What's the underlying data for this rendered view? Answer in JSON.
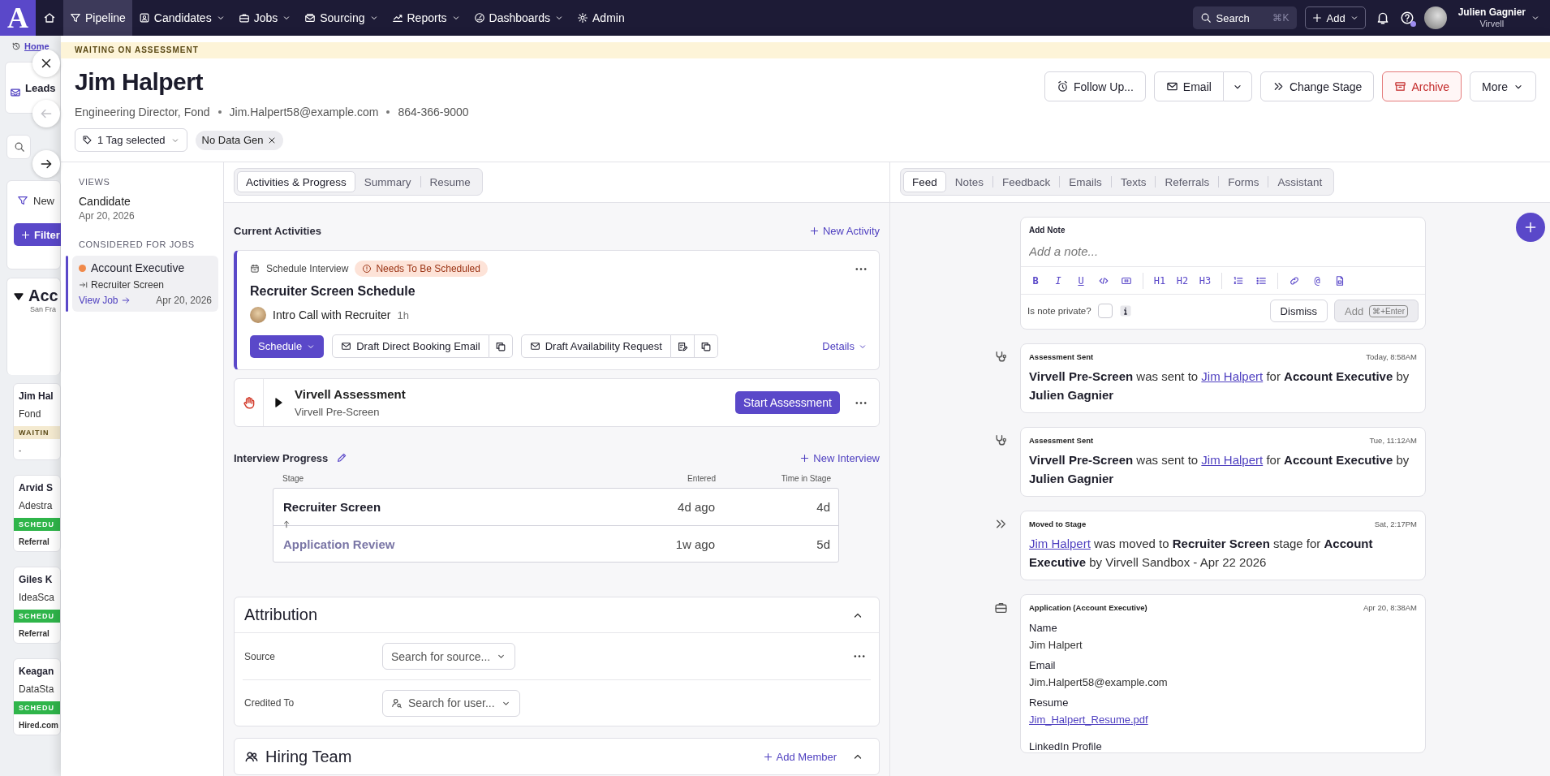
{
  "nav": {
    "logo": "A",
    "items": [
      {
        "label": "Pipeline",
        "selected": true,
        "has_menu": false
      },
      {
        "label": "Candidates",
        "selected": false,
        "has_menu": true
      },
      {
        "label": "Jobs",
        "selected": false,
        "has_menu": true
      },
      {
        "label": "Sourcing",
        "selected": false,
        "has_menu": true
      },
      {
        "label": "Reports",
        "selected": false,
        "has_menu": true
      },
      {
        "label": "Dashboards",
        "selected": false,
        "has_menu": true
      },
      {
        "label": "Admin",
        "selected": false,
        "has_menu": false
      }
    ],
    "search": {
      "label": "Search",
      "shortcut": "⌘K"
    },
    "add_button": "Add",
    "user": {
      "name": "Julien Gagnier",
      "org": "Virvell"
    }
  },
  "background": {
    "breadcrumb": "Home",
    "list_title": "Leads",
    "new_tab": "New",
    "filter_button": "Filter",
    "group": {
      "title": "Acc",
      "subtitle": "San Fra"
    },
    "cards": [
      {
        "name": "Jim Hal",
        "company": "Fond",
        "status": "WAITIN",
        "kind": "waiting",
        "footer": "-"
      },
      {
        "name": "Arvid S",
        "company": "Adestra",
        "status": "SCHEDU",
        "kind": "scheduled",
        "footer": "Referral"
      },
      {
        "name": "Giles K",
        "company": "IdeaSca",
        "status": "SCHEDU",
        "kind": "scheduled",
        "footer": "Referral"
      },
      {
        "name": "Keagan",
        "company": "DataSta",
        "status": "SCHEDU",
        "kind": "scheduled",
        "footer": "Hired.com"
      }
    ]
  },
  "drawer_nav": [
    {
      "kind": "close",
      "disabled": false
    },
    {
      "kind": "previous",
      "disabled": true
    },
    {
      "kind": "next",
      "disabled": false
    }
  ],
  "candidate": {
    "status_banner": "WAITING ON ASSESSMENT",
    "name": "Jim Halpert",
    "details": [
      "Engineering Director, Fond",
      "Jim.Halpert58@example.com",
      "864-366-9000"
    ],
    "tag_select": "1 Tag selected",
    "tags": [
      "No Data Gen"
    ],
    "actions": [
      {
        "label": "Follow Up...",
        "kind": "follow-up"
      },
      {
        "label": "Email",
        "kind": "split"
      },
      {
        "label": "Change Stage",
        "kind": "stage"
      },
      {
        "label": "Archive",
        "kind": "danger"
      },
      {
        "label": "More",
        "kind": "menu"
      }
    ]
  },
  "sidebar": {
    "views_heading": "VIEWS",
    "views": [
      {
        "title": "Candidate",
        "date": "Apr 20, 2026"
      }
    ],
    "jobs_heading": "CONSIDERED FOR JOBS",
    "jobs": [
      {
        "title": "Account Executive",
        "color": "#f0894a",
        "stage": "Recruiter Screen",
        "link": "View Job",
        "date": "Apr 20, 2026",
        "selected": true
      }
    ]
  },
  "activities": {
    "tabs": [
      {
        "label": "Activities & Progress",
        "selected": true
      },
      {
        "label": "Summary",
        "selected": false
      },
      {
        "label": "Resume",
        "selected": false
      }
    ],
    "heading": "Current Activities",
    "new_activity": "New Activity",
    "schedule_card": {
      "type_label": "Schedule Interview",
      "status": "Needs To Be Scheduled",
      "title": "Recruiter Screen Schedule",
      "meeting": "Intro Call with Recruiter",
      "duration": "1h",
      "schedule_button": "Schedule",
      "drafts": [
        "Draft Direct Booking Email",
        "Draft Availability Request"
      ],
      "details": "Details"
    },
    "assessment": {
      "title": "Virvell Assessment",
      "subtitle": "Virvell Pre-Screen",
      "button": "Start Assessment",
      "expanded": false
    },
    "progress": {
      "heading": "Interview Progress",
      "new_interview": "New Interview",
      "columns": [
        "Stage",
        "Entered",
        "Time in Stage"
      ],
      "rows": [
        {
          "stage": "Recruiter Screen",
          "entered": "4d ago",
          "time": "4d",
          "current": true
        },
        {
          "stage": "Application Review",
          "entered": "1w ago",
          "time": "5d",
          "current": false
        }
      ]
    },
    "attribution": {
      "title": "Attribution",
      "expanded": true,
      "fields": [
        {
          "label": "Source",
          "placeholder": "Search for source...",
          "kind": "source"
        },
        {
          "label": "Credited To",
          "placeholder": "Search for user...",
          "kind": "user"
        }
      ]
    },
    "hiring_team": {
      "title": "Hiring Team",
      "add": "Add Member",
      "expanded": true
    }
  },
  "feed": {
    "tabs": [
      {
        "label": "Feed",
        "selected": true
      },
      {
        "label": "Notes",
        "selected": false
      },
      {
        "label": "Feedback",
        "selected": false
      },
      {
        "label": "Emails",
        "selected": false
      },
      {
        "label": "Texts",
        "selected": false
      },
      {
        "label": "Referrals",
        "selected": false
      },
      {
        "label": "Forms",
        "selected": false
      },
      {
        "label": "Assistant",
        "selected": false
      }
    ],
    "note": {
      "title": "Add Note",
      "placeholder": "Add a note...",
      "toolbar": [
        {
          "kind": "bold",
          "label": "B"
        },
        {
          "kind": "italic",
          "label": "I"
        },
        {
          "kind": "underline",
          "label": "U"
        },
        {
          "kind": "code"
        },
        {
          "kind": "embed"
        },
        {
          "kind": "divider"
        },
        {
          "kind": "heading",
          "label": "H1"
        },
        {
          "kind": "heading",
          "label": "H2"
        },
        {
          "kind": "heading",
          "label": "H3"
        },
        {
          "kind": "divider"
        },
        {
          "kind": "ordered-list"
        },
        {
          "kind": "bullet-list"
        },
        {
          "kind": "divider"
        },
        {
          "kind": "link"
        },
        {
          "kind": "mention",
          "label": "@"
        },
        {
          "kind": "file"
        }
      ],
      "private_label": "Is note private?",
      "private": false,
      "dismiss": "Dismiss",
      "add": "Add",
      "add_shortcut": "⌘+Enter"
    },
    "events": [
      {
        "kind": "assessment",
        "title": "Assessment Sent",
        "time": "Today, 8:58AM",
        "parts": [
          {
            "text": "Virvell Pre-Screen",
            "kind": "bold"
          },
          {
            "text": " was sent to ",
            "kind": "plain"
          },
          {
            "text": "Jim Halpert",
            "kind": "link"
          },
          {
            "text": " for ",
            "kind": "plain"
          },
          {
            "text": "Account Executive",
            "kind": "bold"
          },
          {
            "text": " by ",
            "kind": "plain"
          },
          {
            "text": "Julien Gagnier",
            "kind": "bold"
          }
        ]
      },
      {
        "kind": "assessment",
        "title": "Assessment Sent",
        "time": "Tue, 11:12AM",
        "parts": [
          {
            "text": "Virvell Pre-Screen",
            "kind": "bold"
          },
          {
            "text": " was sent to ",
            "kind": "plain"
          },
          {
            "text": "Jim Halpert",
            "kind": "link"
          },
          {
            "text": " for ",
            "kind": "plain"
          },
          {
            "text": "Account Executive",
            "kind": "bold"
          },
          {
            "text": " by ",
            "kind": "plain"
          },
          {
            "text": "Julien Gagnier",
            "kind": "bold"
          }
        ]
      },
      {
        "kind": "stage",
        "title": "Moved to Stage",
        "time": "Sat, 2:17PM",
        "parts": [
          {
            "text": "Jim Halpert",
            "kind": "link"
          },
          {
            "text": " was moved to ",
            "kind": "plain"
          },
          {
            "text": "Recruiter Screen",
            "kind": "bold"
          },
          {
            "text": " stage for ",
            "kind": "plain"
          },
          {
            "text": "Account Executive",
            "kind": "bold"
          },
          {
            "text": " by Virvell Sandbox - Apr 22 2026",
            "kind": "plain"
          }
        ]
      },
      {
        "kind": "application",
        "title": "Application (Account Executive)",
        "time": "Apr 20, 8:38AM",
        "fields": [
          {
            "label": "Name",
            "value": "Jim Halpert",
            "kind": "text"
          },
          {
            "label": "Email",
            "value": "Jim.Halpert58@example.com",
            "kind": "text"
          },
          {
            "label": "Resume",
            "value": "Jim_Halpert_Resume.pdf",
            "kind": "link"
          },
          {
            "label": "LinkedIn Profile",
            "kind": "none"
          }
        ]
      }
    ]
  }
}
